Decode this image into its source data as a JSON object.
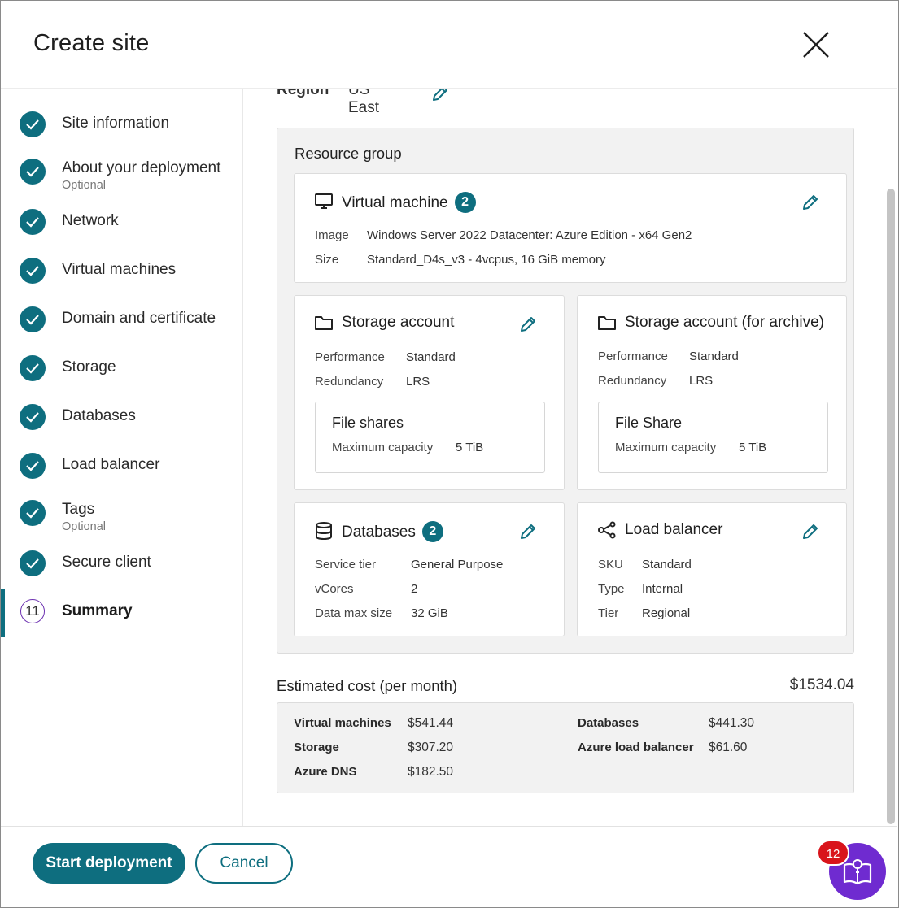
{
  "dialog": {
    "title": "Create site"
  },
  "colors": {
    "accent": "#0e6e7f",
    "help": "#6f2bd0",
    "badge": "#d9141b"
  },
  "steps": [
    {
      "label": "Site information",
      "optional": "",
      "status": "done"
    },
    {
      "label": "About your deployment",
      "optional": "Optional",
      "status": "done"
    },
    {
      "label": "Network",
      "optional": "",
      "status": "done"
    },
    {
      "label": "Virtual machines",
      "optional": "",
      "status": "done"
    },
    {
      "label": "Domain and certificate",
      "optional": "",
      "status": "done"
    },
    {
      "label": "Storage",
      "optional": "",
      "status": "done"
    },
    {
      "label": "Databases",
      "optional": "",
      "status": "done"
    },
    {
      "label": "Load balancer",
      "optional": "",
      "status": "done"
    },
    {
      "label": "Tags",
      "optional": "Optional",
      "status": "done"
    },
    {
      "label": "Secure client",
      "optional": "",
      "status": "done"
    },
    {
      "label": "Summary",
      "optional": "",
      "status": "current",
      "number": "11"
    }
  ],
  "region": {
    "label": "Region",
    "value": "US East"
  },
  "resource_group": {
    "title": "Resource group",
    "virtual_machine": {
      "title": "Virtual machine",
      "count": "2",
      "image_label": "Image",
      "image_value": "Windows Server 2022 Datacenter: Azure Edition - x64 Gen2",
      "size_label": "Size",
      "size_value": "Standard_D4s_v3 - 4vcpus, 16 GiB memory"
    },
    "storage_account": {
      "title": "Storage account",
      "performance_label": "Performance",
      "performance_value": "Standard",
      "redundancy_label": "Redundancy",
      "redundancy_value": "LRS",
      "sub_title": "File shares",
      "capacity_label": "Maximum capacity",
      "capacity_value": "5 TiB"
    },
    "storage_archive": {
      "title": "Storage account (for archive)",
      "performance_label": "Performance",
      "performance_value": "Standard",
      "redundancy_label": "Redundancy",
      "redundancy_value": "LRS",
      "sub_title": "File Share",
      "capacity_label": "Maximum capacity",
      "capacity_value": "5 TiB"
    },
    "databases": {
      "title": "Databases",
      "count": "2",
      "tier_label": "Service tier",
      "tier_value": "General Purpose",
      "vcores_label": "vCores",
      "vcores_value": "2",
      "maxsize_label": "Data max size",
      "maxsize_value": "32 GiB"
    },
    "load_balancer": {
      "title": "Load balancer",
      "sku_label": "SKU",
      "sku_value": "Standard",
      "type_label": "Type",
      "type_value": "Internal",
      "tier_label": "Tier",
      "tier_value": "Regional"
    }
  },
  "cost": {
    "label": "Estimated cost (per month)",
    "total": "$1534.04",
    "items": {
      "vm_label": "Virtual machines",
      "vm_value": "$541.44",
      "storage_label": "Storage",
      "storage_value": "$307.20",
      "dns_label": "Azure DNS",
      "dns_value": "$182.50",
      "db_label": "Databases",
      "db_value": "$441.30",
      "lb_label": "Azure load balancer",
      "lb_value": "$61.60"
    }
  },
  "footer": {
    "start_label": "Start deployment",
    "cancel_label": "Cancel",
    "help_badge": "12"
  }
}
